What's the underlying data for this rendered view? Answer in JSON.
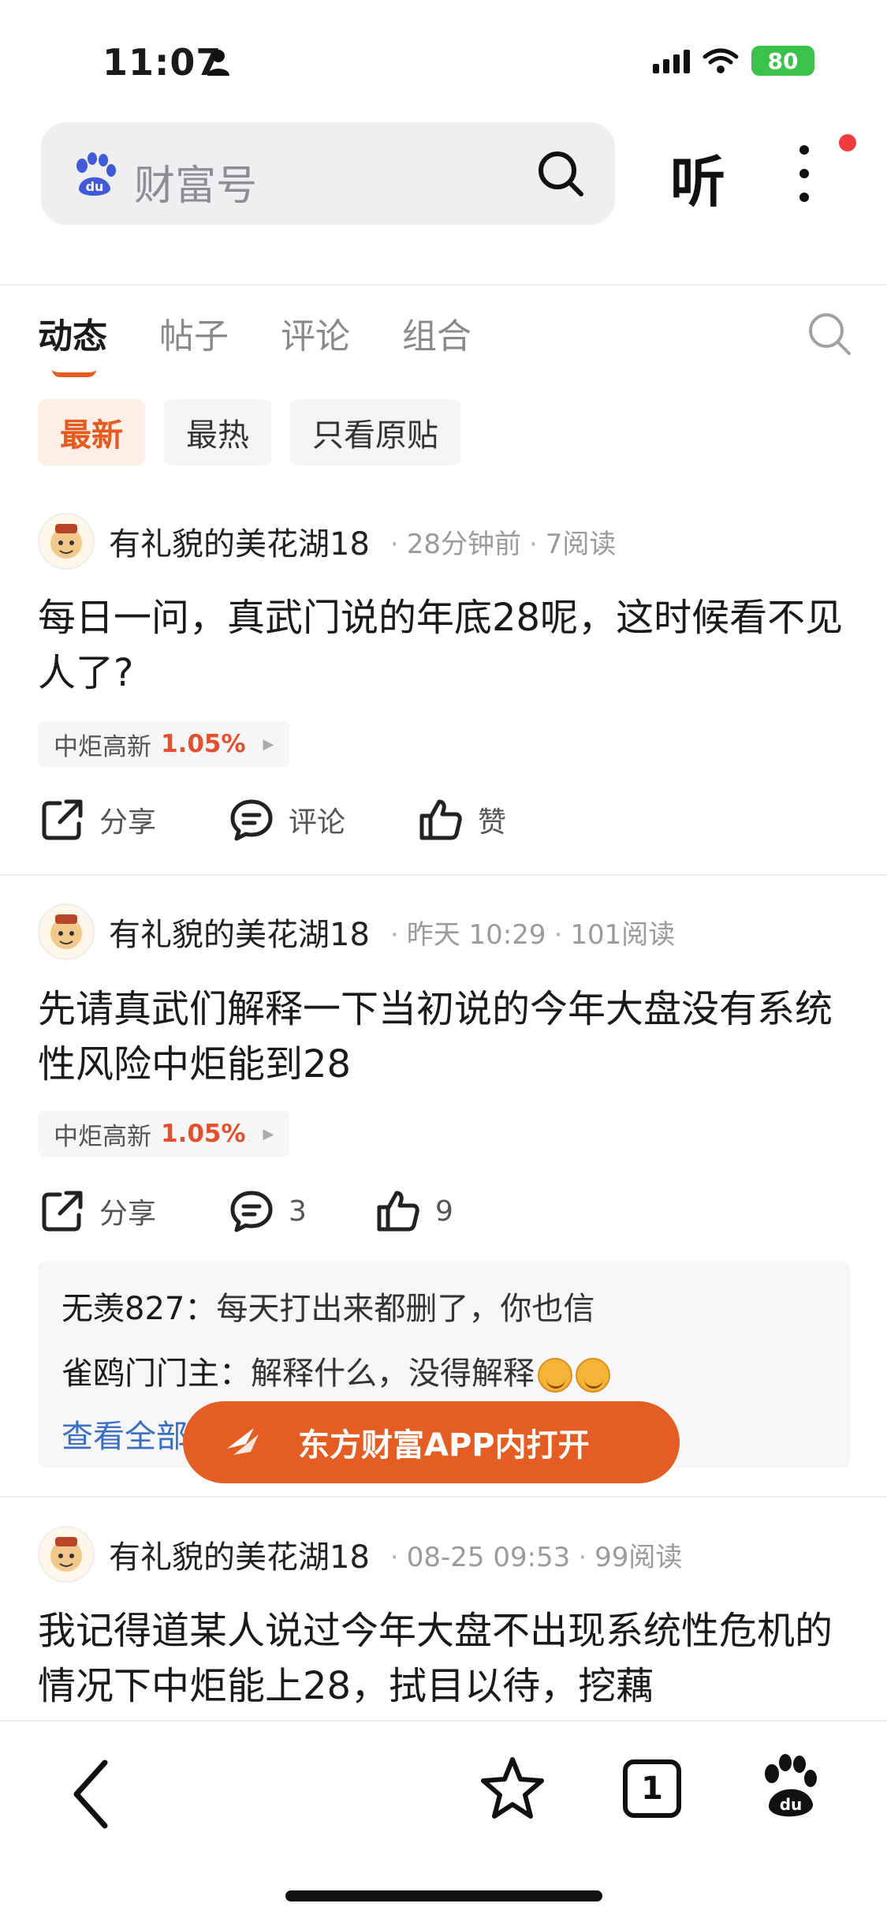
{
  "status_bar": {
    "time": "11:07",
    "battery": "80"
  },
  "search": {
    "placeholder": "财富号",
    "listen_label": "听"
  },
  "tabs": [
    {
      "label": "动态"
    },
    {
      "label": "帖子"
    },
    {
      "label": "评论"
    },
    {
      "label": "组合"
    }
  ],
  "filters": [
    {
      "label": "最新"
    },
    {
      "label": "最热"
    },
    {
      "label": "只看原贴"
    }
  ],
  "posts": [
    {
      "author": "有礼貌的美花湖18",
      "time": "28分钟前",
      "reads": "7阅读",
      "text": "每日一问，真武门说的年底28呢，这时候看不见人了?",
      "stock_name": "中炬高新",
      "stock_change": "1.05%",
      "share_label": "分享",
      "comment_label": "评论",
      "like_label": "赞"
    },
    {
      "author": "有礼貌的美花湖18",
      "time": "昨天 10:29",
      "reads": "101阅读",
      "text": "先请真武们解释一下当初说的今年大盘没有系统性风险中炬能到28",
      "stock_name": "中炬高新",
      "stock_change": "1.05%",
      "share_label": "分享",
      "comment_label": "3",
      "like_label": "9"
    },
    {
      "author": "有礼貌的美花湖18",
      "time": "08-25 09:53",
      "reads": "99阅读",
      "text": "我记得道某人说过今年大盘不出现系统性危机的情况下中炬能上28，拭目以待，挖藕"
    }
  ],
  "comments": [
    {
      "name": "无羡827",
      "sep": "：",
      "text": "每天打出来都删了，你也信"
    },
    {
      "name": "雀鸥门门主",
      "sep": "：",
      "text": "解释什么，没得解释"
    }
  ],
  "view_all": "查看全部",
  "open_app": "东方财富APP内打开",
  "bottom_bar": {
    "tab_count": "1"
  },
  "colors": {
    "accent": "#e55a1e",
    "rise": "#e2502c",
    "link": "#3a6fc3",
    "battery": "#3bc24a"
  }
}
